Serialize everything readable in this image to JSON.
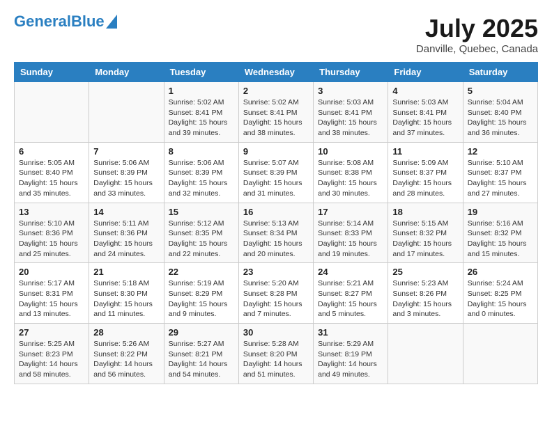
{
  "header": {
    "logo_general": "General",
    "logo_blue": "Blue",
    "month": "July 2025",
    "location": "Danville, Quebec, Canada"
  },
  "weekdays": [
    "Sunday",
    "Monday",
    "Tuesday",
    "Wednesday",
    "Thursday",
    "Friday",
    "Saturday"
  ],
  "weeks": [
    [
      {
        "day": "",
        "sunrise": "",
        "sunset": "",
        "daylight": ""
      },
      {
        "day": "",
        "sunrise": "",
        "sunset": "",
        "daylight": ""
      },
      {
        "day": "1",
        "sunrise": "Sunrise: 5:02 AM",
        "sunset": "Sunset: 8:41 PM",
        "daylight": "Daylight: 15 hours and 39 minutes."
      },
      {
        "day": "2",
        "sunrise": "Sunrise: 5:02 AM",
        "sunset": "Sunset: 8:41 PM",
        "daylight": "Daylight: 15 hours and 38 minutes."
      },
      {
        "day": "3",
        "sunrise": "Sunrise: 5:03 AM",
        "sunset": "Sunset: 8:41 PM",
        "daylight": "Daylight: 15 hours and 38 minutes."
      },
      {
        "day": "4",
        "sunrise": "Sunrise: 5:03 AM",
        "sunset": "Sunset: 8:41 PM",
        "daylight": "Daylight: 15 hours and 37 minutes."
      },
      {
        "day": "5",
        "sunrise": "Sunrise: 5:04 AM",
        "sunset": "Sunset: 8:40 PM",
        "daylight": "Daylight: 15 hours and 36 minutes."
      }
    ],
    [
      {
        "day": "6",
        "sunrise": "Sunrise: 5:05 AM",
        "sunset": "Sunset: 8:40 PM",
        "daylight": "Daylight: 15 hours and 35 minutes."
      },
      {
        "day": "7",
        "sunrise": "Sunrise: 5:06 AM",
        "sunset": "Sunset: 8:39 PM",
        "daylight": "Daylight: 15 hours and 33 minutes."
      },
      {
        "day": "8",
        "sunrise": "Sunrise: 5:06 AM",
        "sunset": "Sunset: 8:39 PM",
        "daylight": "Daylight: 15 hours and 32 minutes."
      },
      {
        "day": "9",
        "sunrise": "Sunrise: 5:07 AM",
        "sunset": "Sunset: 8:39 PM",
        "daylight": "Daylight: 15 hours and 31 minutes."
      },
      {
        "day": "10",
        "sunrise": "Sunrise: 5:08 AM",
        "sunset": "Sunset: 8:38 PM",
        "daylight": "Daylight: 15 hours and 30 minutes."
      },
      {
        "day": "11",
        "sunrise": "Sunrise: 5:09 AM",
        "sunset": "Sunset: 8:37 PM",
        "daylight": "Daylight: 15 hours and 28 minutes."
      },
      {
        "day": "12",
        "sunrise": "Sunrise: 5:10 AM",
        "sunset": "Sunset: 8:37 PM",
        "daylight": "Daylight: 15 hours and 27 minutes."
      }
    ],
    [
      {
        "day": "13",
        "sunrise": "Sunrise: 5:10 AM",
        "sunset": "Sunset: 8:36 PM",
        "daylight": "Daylight: 15 hours and 25 minutes."
      },
      {
        "day": "14",
        "sunrise": "Sunrise: 5:11 AM",
        "sunset": "Sunset: 8:36 PM",
        "daylight": "Daylight: 15 hours and 24 minutes."
      },
      {
        "day": "15",
        "sunrise": "Sunrise: 5:12 AM",
        "sunset": "Sunset: 8:35 PM",
        "daylight": "Daylight: 15 hours and 22 minutes."
      },
      {
        "day": "16",
        "sunrise": "Sunrise: 5:13 AM",
        "sunset": "Sunset: 8:34 PM",
        "daylight": "Daylight: 15 hours and 20 minutes."
      },
      {
        "day": "17",
        "sunrise": "Sunrise: 5:14 AM",
        "sunset": "Sunset: 8:33 PM",
        "daylight": "Daylight: 15 hours and 19 minutes."
      },
      {
        "day": "18",
        "sunrise": "Sunrise: 5:15 AM",
        "sunset": "Sunset: 8:32 PM",
        "daylight": "Daylight: 15 hours and 17 minutes."
      },
      {
        "day": "19",
        "sunrise": "Sunrise: 5:16 AM",
        "sunset": "Sunset: 8:32 PM",
        "daylight": "Daylight: 15 hours and 15 minutes."
      }
    ],
    [
      {
        "day": "20",
        "sunrise": "Sunrise: 5:17 AM",
        "sunset": "Sunset: 8:31 PM",
        "daylight": "Daylight: 15 hours and 13 minutes."
      },
      {
        "day": "21",
        "sunrise": "Sunrise: 5:18 AM",
        "sunset": "Sunset: 8:30 PM",
        "daylight": "Daylight: 15 hours and 11 minutes."
      },
      {
        "day": "22",
        "sunrise": "Sunrise: 5:19 AM",
        "sunset": "Sunset: 8:29 PM",
        "daylight": "Daylight: 15 hours and 9 minutes."
      },
      {
        "day": "23",
        "sunrise": "Sunrise: 5:20 AM",
        "sunset": "Sunset: 8:28 PM",
        "daylight": "Daylight: 15 hours and 7 minutes."
      },
      {
        "day": "24",
        "sunrise": "Sunrise: 5:21 AM",
        "sunset": "Sunset: 8:27 PM",
        "daylight": "Daylight: 15 hours and 5 minutes."
      },
      {
        "day": "25",
        "sunrise": "Sunrise: 5:23 AM",
        "sunset": "Sunset: 8:26 PM",
        "daylight": "Daylight: 15 hours and 3 minutes."
      },
      {
        "day": "26",
        "sunrise": "Sunrise: 5:24 AM",
        "sunset": "Sunset: 8:25 PM",
        "daylight": "Daylight: 15 hours and 0 minutes."
      }
    ],
    [
      {
        "day": "27",
        "sunrise": "Sunrise: 5:25 AM",
        "sunset": "Sunset: 8:23 PM",
        "daylight": "Daylight: 14 hours and 58 minutes."
      },
      {
        "day": "28",
        "sunrise": "Sunrise: 5:26 AM",
        "sunset": "Sunset: 8:22 PM",
        "daylight": "Daylight: 14 hours and 56 minutes."
      },
      {
        "day": "29",
        "sunrise": "Sunrise: 5:27 AM",
        "sunset": "Sunset: 8:21 PM",
        "daylight": "Daylight: 14 hours and 54 minutes."
      },
      {
        "day": "30",
        "sunrise": "Sunrise: 5:28 AM",
        "sunset": "Sunset: 8:20 PM",
        "daylight": "Daylight: 14 hours and 51 minutes."
      },
      {
        "day": "31",
        "sunrise": "Sunrise: 5:29 AM",
        "sunset": "Sunset: 8:19 PM",
        "daylight": "Daylight: 14 hours and 49 minutes."
      },
      {
        "day": "",
        "sunrise": "",
        "sunset": "",
        "daylight": ""
      },
      {
        "day": "",
        "sunrise": "",
        "sunset": "",
        "daylight": ""
      }
    ]
  ]
}
